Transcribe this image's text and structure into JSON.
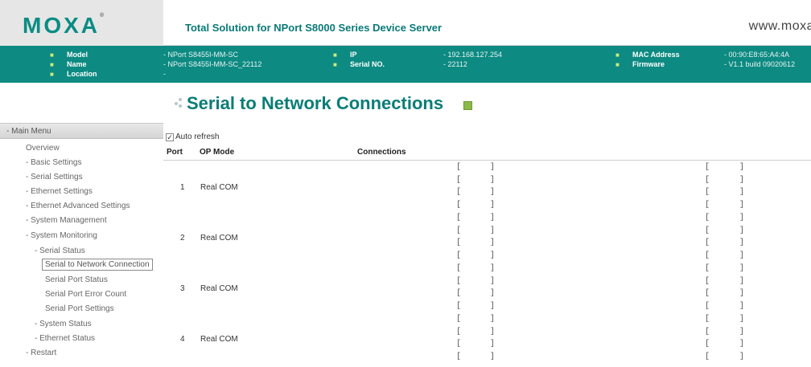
{
  "header": {
    "logo": "MOXA",
    "logo_mark": "®",
    "title": "Total Solution for NPort S8000 Series Device Server",
    "url": "www.moxa"
  },
  "info": {
    "model_label": "Model",
    "model_value": "- NPort S8455I-MM-SC",
    "name_label": "Name",
    "name_value": "- NPort S8455I-MM-SC_22112",
    "location_label": "Location",
    "location_value": "-",
    "ip_label": "IP",
    "ip_value": "- 192.168.127.254",
    "serial_label": "Serial NO.",
    "serial_value": "- 22112",
    "mac_label": "MAC Address",
    "mac_value": "- 00:90:E8:65:A4:4A",
    "firmware_label": "Firmware",
    "firmware_value": "- V1.1 build 09020612",
    "bullet": "■"
  },
  "menu": {
    "head": "- Main Menu",
    "items": [
      "Overview",
      "- Basic Settings",
      "- Serial Settings",
      "- Ethernet Settings",
      "- Ethernet Advanced Settings",
      "- System Management",
      "- System Monitoring",
      "- Serial Status",
      "Serial to Network Connection",
      "Serial Port Status",
      "Serial Port Error Count",
      "Serial Port Settings",
      "- System Status",
      "- Ethernet Status",
      "- Restart"
    ]
  },
  "main": {
    "title": "Serial to Network Connections",
    "auto_refresh_label": "Auto refresh",
    "auto_refresh_checked": "✓",
    "columns": {
      "port": "Port",
      "op_mode": "OP Mode",
      "connections": "Connections"
    },
    "rows": [
      {
        "port": "1",
        "mode": "Real COM"
      },
      {
        "port": "2",
        "mode": "Real COM"
      },
      {
        "port": "3",
        "mode": "Real COM"
      },
      {
        "port": "4",
        "mode": "Real COM"
      }
    ],
    "bracket_open": "[",
    "bracket_close": "]"
  }
}
